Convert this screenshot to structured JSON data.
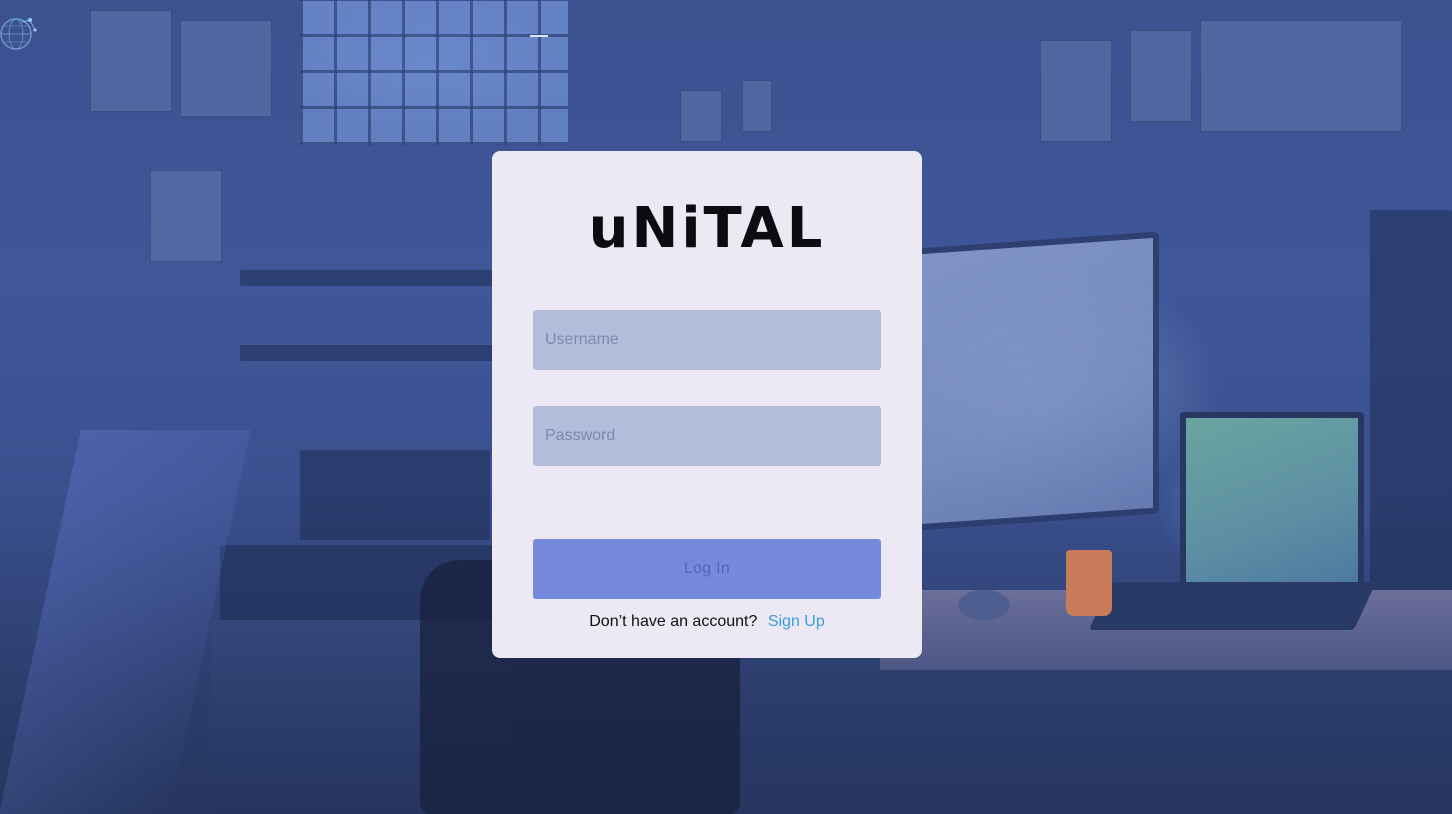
{
  "app": {
    "brand": "uNiTAL"
  },
  "login_form": {
    "username_placeholder": "Username",
    "password_placeholder": "Password",
    "login_button_label": "Log In",
    "signup_prompt": "Don’t have an account?",
    "signup_link_label": "Sign Up"
  },
  "colors": {
    "card_background": "#ece8f4",
    "input_background": "#b3bcdb",
    "button_background": "#7589dd",
    "link_color": "#3c9edb",
    "page_background": "#3f5799"
  },
  "icons": {
    "corner_logo": "globe-network-icon"
  }
}
